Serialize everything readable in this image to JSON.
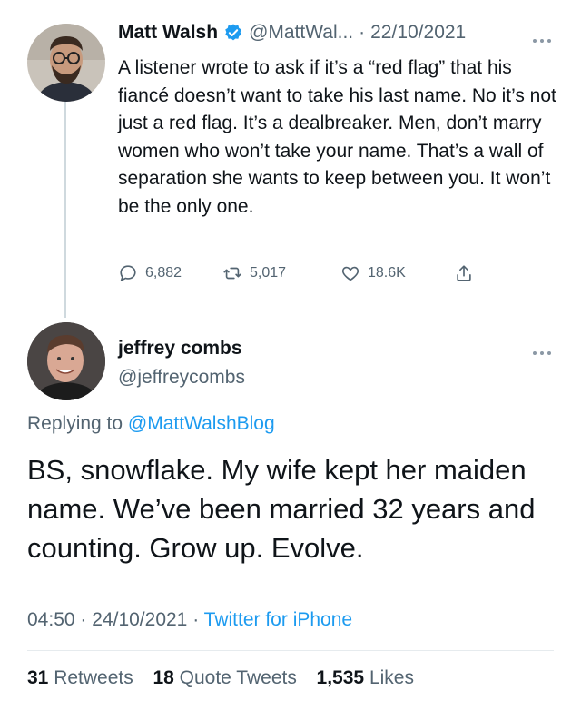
{
  "original_tweet": {
    "author_name": "Matt Walsh",
    "verified": true,
    "handle": "@MattWal...",
    "date": "22/10/2021",
    "text": "A listener wrote to ask if it’s a “red flag” that his fiancé doesn’t want to take his last name. No it’s not just a red flag. It’s a dealbreaker. Men, don’t marry women who won’t take your name. That’s a wall of separation she wants to keep between you. It won’t be the only one.",
    "replies": "6,882",
    "retweets": "5,017",
    "likes": "18.6K"
  },
  "reply_tweet": {
    "author_name": "jeffrey combs",
    "handle": "@jeffreycombs",
    "replying_prefix": "Replying to",
    "replying_to": "@MattWalshBlog",
    "text": "BS, snowflake. My wife kept her maiden name. We’ve been married 32 years and counting. Grow up. Evolve.",
    "time": "04:50",
    "date": "24/10/2021",
    "client": "Twitter for iPhone",
    "retweet_count": "31",
    "retweet_label": "Retweets",
    "quote_count": "18",
    "quote_label": "Quote Tweets",
    "like_count": "1,535",
    "like_label": "Likes"
  },
  "colors": {
    "accent": "#1d9bf0",
    "secondary_text": "#536471",
    "thread_line": "#cfd9de"
  }
}
